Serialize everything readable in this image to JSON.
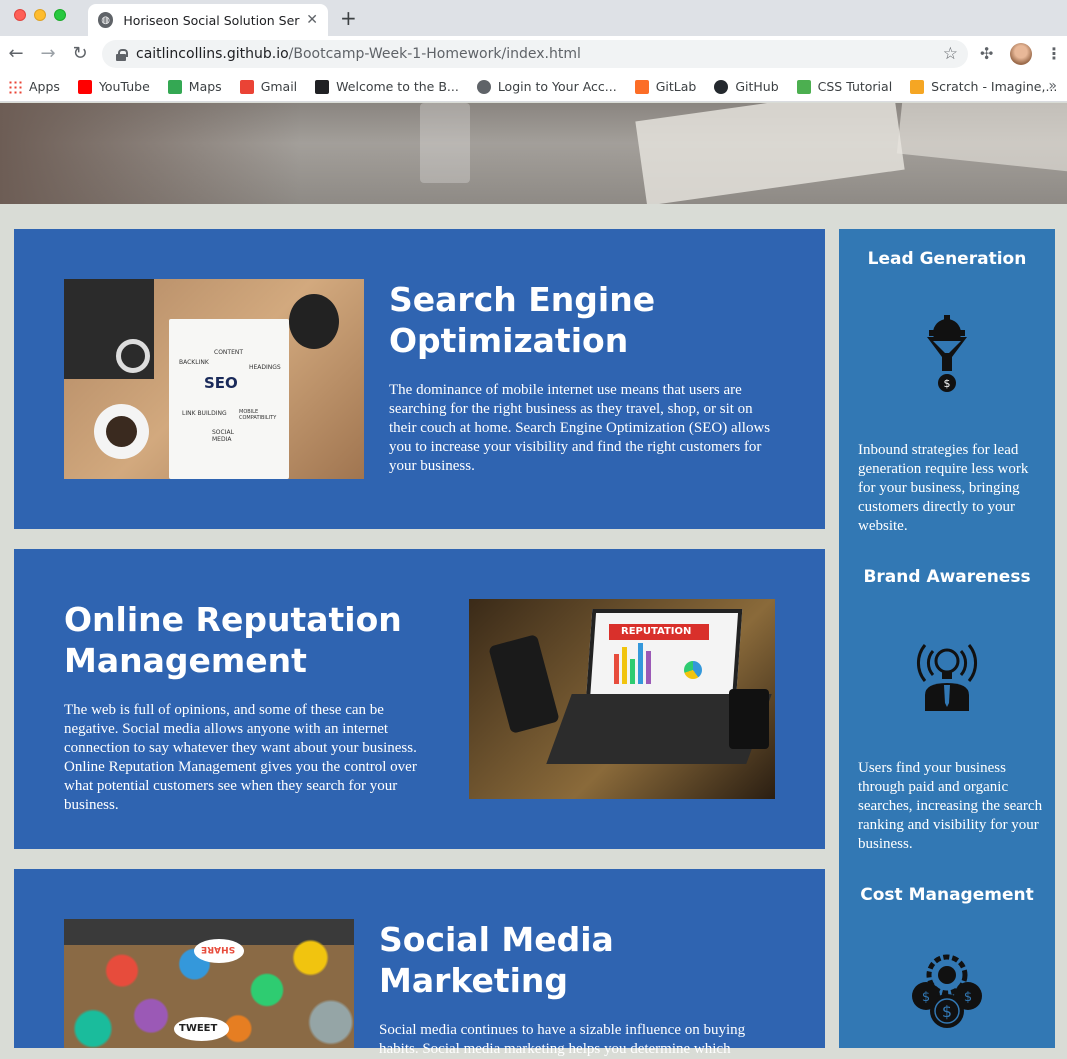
{
  "browser": {
    "tab_title": "Horiseon Social Solution Servic",
    "tab_close": "✕",
    "new_tab": "+",
    "url_host": "caitlincollins.github.io",
    "url_path": "/Bootcamp-Week-1-Homework/index.html",
    "bookmarks": [
      {
        "label": "Apps",
        "icon": "apps-grid-icon",
        "color": "#4285f4"
      },
      {
        "label": "YouTube",
        "icon": "youtube-icon",
        "color": "#ff0000"
      },
      {
        "label": "Maps",
        "icon": "maps-icon",
        "color": "#34a853"
      },
      {
        "label": "Gmail",
        "icon": "gmail-icon",
        "color": "#ea4335"
      },
      {
        "label": "Welcome to the B...",
        "icon": "book-icon",
        "color": "#202124"
      },
      {
        "label": "Login to Your Acc...",
        "icon": "globe-icon",
        "color": "#5f6368"
      },
      {
        "label": "GitLab",
        "icon": "gitlab-icon",
        "color": "#fc6d26"
      },
      {
        "label": "GitHub",
        "icon": "github-icon",
        "color": "#24292e"
      },
      {
        "label": "CSS Tutorial",
        "icon": "w3schools-icon",
        "color": "#4caf50"
      },
      {
        "label": "Scratch - Imagine,...",
        "icon": "scratch-icon",
        "color": "#f5a623"
      }
    ],
    "more": "»"
  },
  "sections": [
    {
      "title": "Search Engine Optimization",
      "body": "The dominance of mobile internet use means that users are searching for the right business as they travel, shop, or sit on their couch at home. Search Engine Optimization (SEO) allows you to increase your visibility and find the right customers for your business.",
      "image_words": [
        "BACKLINK",
        "CONTENT",
        "SEO",
        "HEADINGS",
        "LINK BUILDING",
        "MOBILE COMPATIBILITY",
        "SOCIAL MEDIA"
      ]
    },
    {
      "title": "Online Reputation Management",
      "body": "The web is full of opinions, and some of these can be negative. Social media allows anyone with an internet connection to say whatever they want about your business. Online Reputation Management gives you the control over what potential customers see when they search for your business.",
      "image_words": [
        "REPUTATION"
      ]
    },
    {
      "title": "Social Media Marketing",
      "body": "Social media continues to have a sizable influence on buying habits. Social media marketing helps you determine which",
      "image_words": [
        "SHARE",
        "TWEET"
      ]
    }
  ],
  "benefits": [
    {
      "title": "Lead Generation",
      "body": "Inbound strategies for lead generation require less work for your business, bringing customers directly to your website.",
      "icon": "lead-generation-funnel-icon"
    },
    {
      "title": "Brand Awareness",
      "body": "Users find your business through paid and organic searches, increasing the search ranking and visibility for your business.",
      "icon": "brand-awareness-broadcast-icon"
    },
    {
      "title": "Cost Management",
      "body": "",
      "icon": "cost-management-coins-icon"
    }
  ],
  "colors": {
    "page_bg": "#d9dcd6",
    "card_bg": "#2f64b1",
    "aside_bg": "#3278b4"
  }
}
